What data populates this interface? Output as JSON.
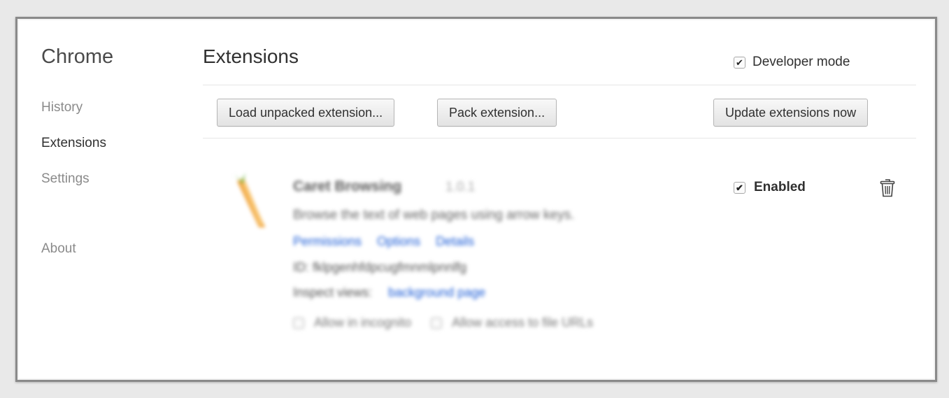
{
  "sidebar": {
    "title": "Chrome",
    "items": [
      {
        "label": "History",
        "selected": false
      },
      {
        "label": "Extensions",
        "selected": true
      },
      {
        "label": "Settings",
        "selected": false
      },
      {
        "label": "About",
        "selected": false
      }
    ]
  },
  "header": {
    "title": "Extensions",
    "developer_mode": {
      "label": "Developer mode",
      "checked": true
    }
  },
  "toolbar": {
    "load_unpacked_label": "Load unpacked extension...",
    "pack_label": "Pack extension...",
    "update_label": "Update extensions now"
  },
  "extension": {
    "name": "Caret Browsing",
    "version": "1.0.1",
    "description": "Browse the text of web pages using arrow keys.",
    "links": {
      "permissions": "Permissions",
      "options": "Options",
      "details": "Details"
    },
    "id_text": "ID: fklpgenhfdpcugfmnmlpnnlfg",
    "inspect_label": "Inspect views:",
    "inspect_link": "background page",
    "allow_incognito": "Allow in incognito",
    "allow_file_urls": "Allow access to file URLs",
    "enabled_label": "Enabled",
    "enabled_checked": true,
    "icon": "carrot-icon"
  },
  "colors": {
    "link": "#1a5bd6",
    "text": "#303030",
    "muted": "#8a8a8a"
  }
}
